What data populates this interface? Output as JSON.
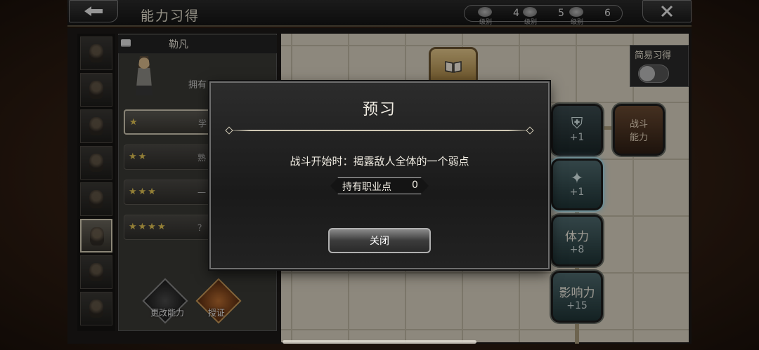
{
  "header": {
    "title": "能力习得",
    "levels": [
      {
        "caption": "级别",
        "value": "4"
      },
      {
        "caption": "级别",
        "value": "5"
      },
      {
        "caption": "级别",
        "value": "6"
      }
    ]
  },
  "job_panel": {
    "name": "勒凡",
    "owned_label": "拥有",
    "ranks": [
      {
        "stars": "★",
        "label": "学"
      },
      {
        "stars": "★★",
        "label": "熟"
      },
      {
        "stars": "★★★",
        "label": "一"
      },
      {
        "stars": "★★★★",
        "label": "？"
      }
    ],
    "change_ability_label": "更改能力",
    "cert_label": "授证"
  },
  "board": {
    "easy_learn_label": "简易习得",
    "nodes": {
      "battle_ability": "战斗\n能力",
      "vitality_title": "体力",
      "vitality_value": "+8",
      "influence_title": "影响力",
      "influence_value": "+15",
      "plus_one": "+1"
    }
  },
  "modal": {
    "title": "预习",
    "description": "战斗开始时：揭露敌人全体的一个弱点",
    "job_points_label": "持有职业点",
    "job_points_value": "0",
    "close_label": "关闭"
  }
}
